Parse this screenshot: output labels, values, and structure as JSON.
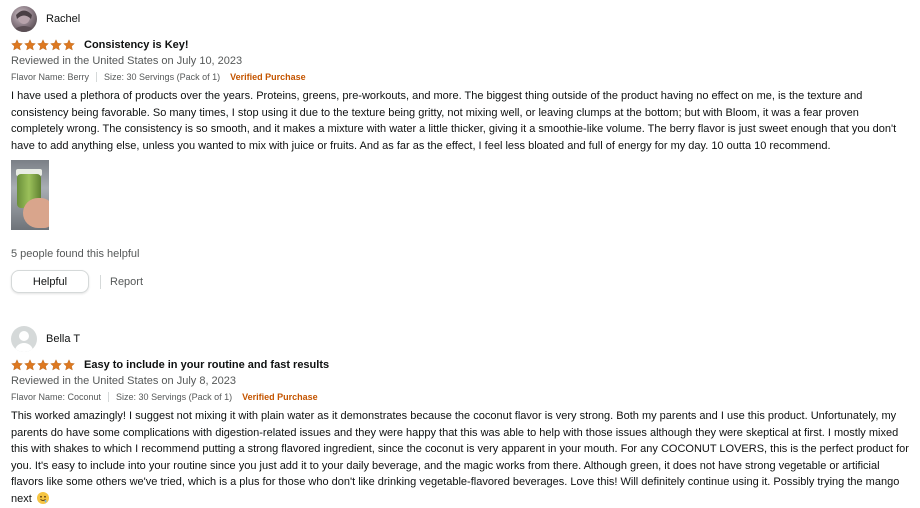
{
  "reviews": [
    {
      "profile_name": "Rachel",
      "avatar": "user-photo-avatar",
      "rating": 5,
      "title": "Consistency is Key!",
      "date": "Reviewed in the United States on July 10, 2023",
      "flavor": "Flavor Name: Berry",
      "size": "Size: 30 Servings (Pack of 1)",
      "verified": "Verified Purchase",
      "body": "I have used a plethora of products over the years. Proteins, greens, pre-workouts, and more. The biggest thing outside of the product having no effect on me, is the texture and consistency being favorable. So many times, I stop using it due to the texture being gritty, not mixing well, or leaving clumps at the bottom; but with Bloom, it was a fear proven completely wrong. The consistency is so smooth, and it makes a mixture with water a little thicker, giving it a smoothie-like volume. The berry flavor is just sweet enough that you don't have to add anything else, unless you wanted to mix with juice or fruits. And as far as the effect, I feel less bloated and full of energy for my day. 10 outta 10 recommend.",
      "helpful_count": "5 people found this helpful",
      "helpful_label": "Helpful",
      "report_label": "Report"
    },
    {
      "profile_name": "Bella T",
      "avatar": "default-user-avatar",
      "rating": 5,
      "title": "Easy to include in your routine and fast results",
      "date": "Reviewed in the United States on July 8, 2023",
      "flavor": "Flavor Name: Coconut",
      "size": "Size: 30 Servings (Pack of 1)",
      "verified": "Verified Purchase",
      "body": "This worked amazingly! I suggest not mixing it with plain water as it demonstrates because the coconut flavor is very strong. Both my parents and I use this product. Unfortunately, my parents do have some complications with digestion-related issues and they were happy that this was able to help with those issues although they were skeptical at first. I mostly mixed this with shakes to which I recommend putting a strong flavored ingredient, since the coconut is very apparent in your mouth. For any COCONUT LOVERS, this is the perfect product for you. It's easy to include into your routine since you just add it to your daily beverage, and the magic works from there. Although green, it does not have strong vegetable or artificial flavors like some others we've tried, which is a plus for those who don't like drinking vegetable-flavored beverages. Love this! Will definitely continue using it. Possibly trying the mango next"
    }
  ],
  "colors": {
    "star": "#de7921",
    "verified": "#c45500",
    "text": "#0f1111",
    "muted": "#565959"
  }
}
